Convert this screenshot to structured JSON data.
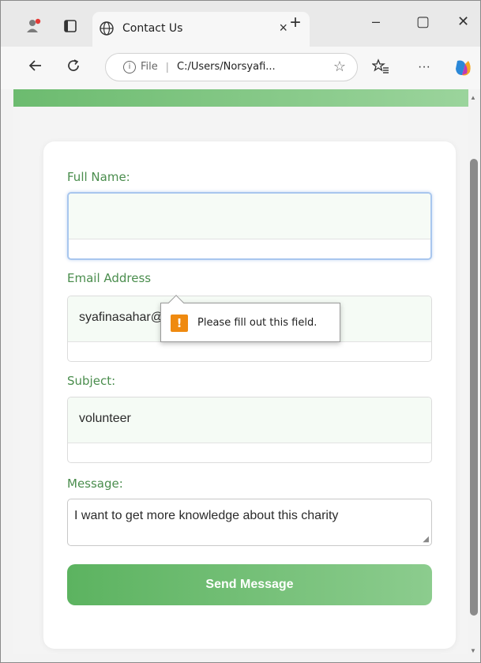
{
  "browser": {
    "tab_title": "Contact Us",
    "tab_close": "×",
    "new_tab": "+",
    "minimize": "–",
    "maximize": "▢",
    "close": "✕",
    "address_file": "File",
    "address_separator": "|",
    "address_url": "C:/Users/Norsyafi...",
    "more": "···"
  },
  "form": {
    "name_label": "Full Name:",
    "name_value": "",
    "email_label": "Email Address",
    "email_value": "syafinasahar@gmail.com",
    "subject_label": "Subject:",
    "subject_value": "volunteer",
    "message_label": "Message:",
    "message_value": "I want to get more knowledge about this charity",
    "send_label": "Send Message"
  },
  "tooltip": {
    "icon": "!",
    "text": "Please fill out this field."
  },
  "colors": {
    "accent_green": "#5cb360",
    "label_green": "#4a8d4d",
    "warning_orange": "#ef8a10"
  }
}
